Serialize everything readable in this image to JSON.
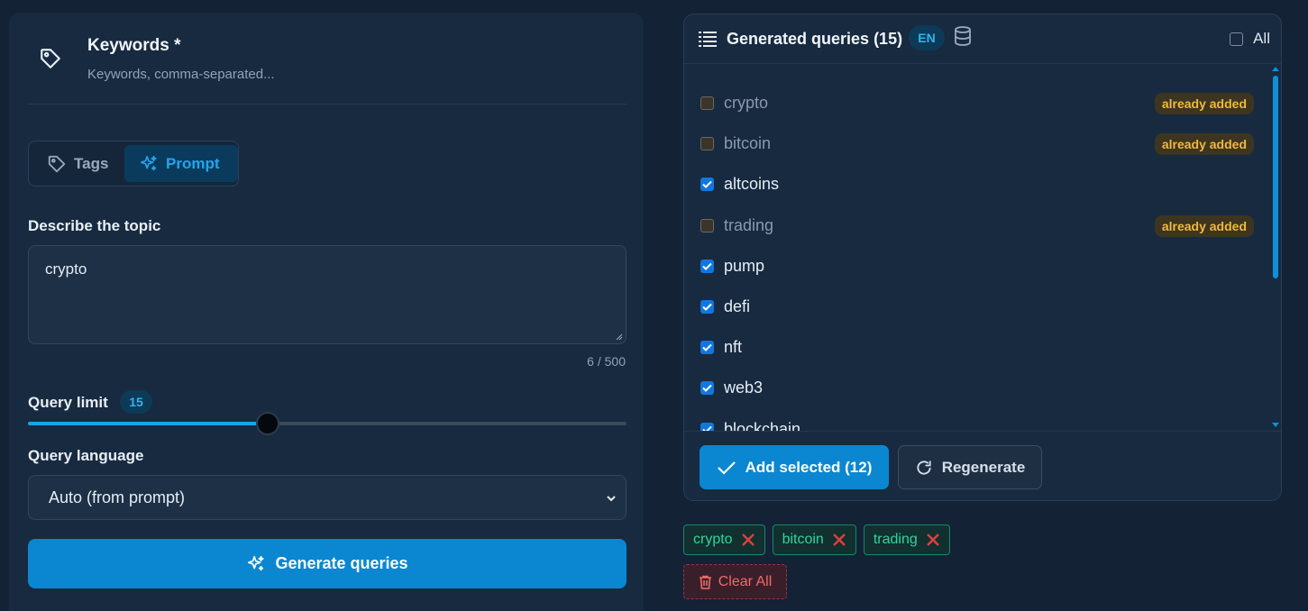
{
  "keywords": {
    "title": "Keywords *",
    "subtitle": "Keywords, comma-separated...",
    "icon": "tag-icon"
  },
  "mode_toggle": {
    "tabs": [
      {
        "label": "Tags",
        "icon": "tag-icon",
        "active": false
      },
      {
        "label": "Prompt",
        "icon": "sparkles-icon",
        "active": true
      }
    ]
  },
  "topic": {
    "label": "Describe the topic",
    "value": "crypto",
    "char_count": "6 / 500"
  },
  "query_limit": {
    "label": "Query limit",
    "value": "15",
    "slider_fraction": 0.4
  },
  "query_language": {
    "label": "Query language",
    "selected": "Auto (from prompt)"
  },
  "generate_button": {
    "label": "Generate queries"
  },
  "generated": {
    "title": "Generated queries (15)",
    "lang_badge": "EN",
    "all_label": "All",
    "added_badge": "already added",
    "items": [
      {
        "label": "crypto",
        "checked": false,
        "added": true
      },
      {
        "label": "bitcoin",
        "checked": false,
        "added": true
      },
      {
        "label": "altcoins",
        "checked": true,
        "added": false
      },
      {
        "label": "trading",
        "checked": false,
        "added": true
      },
      {
        "label": "pump",
        "checked": true,
        "added": false
      },
      {
        "label": "defi",
        "checked": true,
        "added": false
      },
      {
        "label": "nft",
        "checked": true,
        "added": false
      },
      {
        "label": "web3",
        "checked": true,
        "added": false
      },
      {
        "label": "blockchain",
        "checked": true,
        "added": false
      }
    ],
    "add_button": "Add selected (12)",
    "regenerate_button": "Regenerate"
  },
  "chips": [
    "crypto",
    "bitcoin",
    "trading"
  ],
  "clear_all": "Clear All",
  "colors": {
    "accent": "#0a87d0",
    "chip_text": "#2fd59c",
    "warning": "#f0b93a",
    "danger": "#f06a6a"
  }
}
